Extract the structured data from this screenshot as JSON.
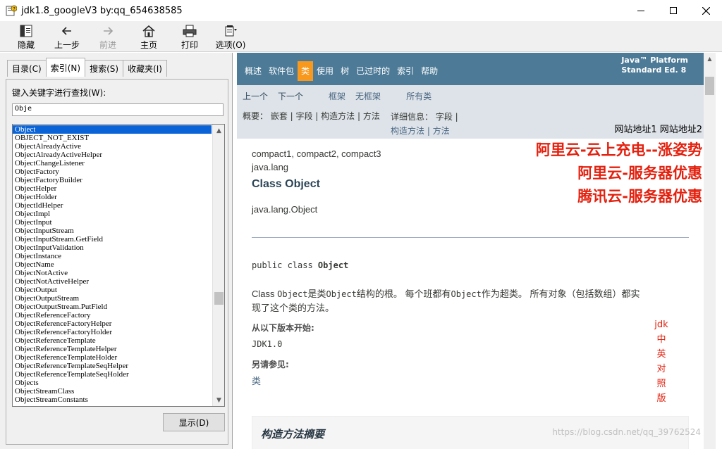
{
  "window": {
    "title": "jdk1.8_googleV3 by:qq_654638585",
    "controls": [
      "minimize",
      "maximize",
      "close"
    ]
  },
  "toolbar": {
    "buttons": [
      {
        "label": "隐藏",
        "icon": "hide-icon",
        "enabled": true
      },
      {
        "label": "上一步",
        "icon": "back-arrow-icon",
        "enabled": true
      },
      {
        "label": "前进",
        "icon": "forward-arrow-icon",
        "enabled": false
      },
      {
        "label": "主页",
        "icon": "home-icon",
        "enabled": true
      },
      {
        "label": "打印",
        "icon": "printer-icon",
        "enabled": true
      },
      {
        "label": "选项(O)",
        "icon": "options-icon",
        "enabled": true
      }
    ]
  },
  "left": {
    "tabs": [
      "目录(C)",
      "索引(N)",
      "搜索(S)",
      "收藏夹(I)"
    ],
    "active_tab": "索引(N)",
    "keyword_label": "键入关键字进行查找(W):",
    "keyword_value": "Obje",
    "list": [
      "Object",
      "OBJECT_NOT_EXIST",
      "ObjectAlreadyActive",
      "ObjectAlreadyActiveHelper",
      "ObjectChangeListener",
      "ObjectFactory",
      "ObjectFactoryBuilder",
      "ObjectHelper",
      "ObjectHolder",
      "ObjectIdHelper",
      "ObjectImpl",
      "ObjectInput",
      "ObjectInputStream",
      "ObjectInputStream.GetField",
      "ObjectInputValidation",
      "ObjectInstance",
      "ObjectName",
      "ObjectNotActive",
      "ObjectNotActiveHelper",
      "ObjectOutput",
      "ObjectOutputStream",
      "ObjectOutputStream.PutField",
      "ObjectReferenceFactory",
      "ObjectReferenceFactoryHelper",
      "ObjectReferenceFactoryHolder",
      "ObjectReferenceTemplate",
      "ObjectReferenceTemplateHelper",
      "ObjectReferenceTemplateHolder",
      "ObjectReferenceTemplateSeqHelper",
      "ObjectReferenceTemplateSeqHolder",
      "Objects",
      "ObjectStreamClass",
      "ObjectStreamConstants"
    ],
    "selected_item": "Object",
    "display_button": "显示(D)"
  },
  "doc": {
    "nav": [
      "概述",
      "软件包",
      "类",
      "使用",
      "树",
      "已过时的",
      "索引",
      "帮助"
    ],
    "nav_active": "类",
    "platform_line1": "Java™ Platform",
    "platform_line2": "Standard Ed. 8",
    "prev_class": "上一个",
    "next_class": "下一个",
    "frames": "框架",
    "no_frames": "无框架",
    "all_classes": "所有类",
    "summary_line": "概要： 嵌套 | 字段 | 构造方法 | 方法",
    "detail_label": "详细信息： 字段 |",
    "detail_line2": "构造方法 | 方法",
    "site_addr": "网站地址1 网站地址2",
    "profiles": "compact1, compact2, compact3",
    "package": "java.lang",
    "class_title": "Class Object",
    "inheritance": "java.lang.Object",
    "signature_prefix": "public class ",
    "signature_name": "Object",
    "desc_line1_a": "Class ",
    "desc_line1_b": "Object",
    "desc_line1_c": "是类",
    "desc_line1_d": "Object",
    "desc_line1_e": "结构的根。 每个班都有",
    "desc_line1_f": "Object",
    "desc_line1_g": "作为超类。 所有对象（包括数组）都实",
    "desc_line2": "现了这个类的方法。",
    "since_label": "从以下版本开始:",
    "since_value": "JDK1.0",
    "see_also_label": "另请参见:",
    "see_also_value": "类",
    "ads": [
      "阿里云-云上充电--涨姿势",
      "阿里云-服务器优惠",
      "腾讯云-服务器优惠"
    ],
    "vertical_note": [
      "jdk",
      "中",
      "英",
      "对",
      "照",
      "版"
    ],
    "summary_title": "构造方法摘要",
    "watermark": "https://blog.csdn.net/qq_39762524",
    "colors": {
      "nav_bg": "#4d7a97",
      "nav_active": "#f8981d",
      "subnav_bg": "#dee3e9",
      "ad_red": "#e4200e"
    }
  }
}
